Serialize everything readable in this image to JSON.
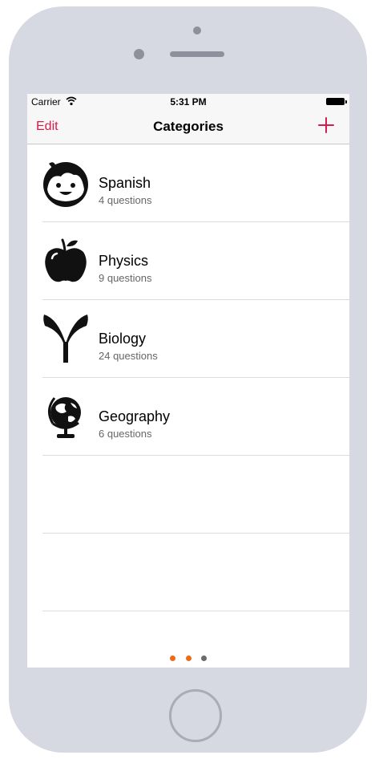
{
  "status_bar": {
    "carrier": "Carrier",
    "time": "5:31 PM"
  },
  "nav_bar": {
    "left_label": "Edit",
    "title": "Categories",
    "right_icon": "plus-icon",
    "accent_color": "#d81b4a"
  },
  "categories": [
    {
      "name": "Spanish",
      "count_label": "4 questions",
      "icon": "child-face-icon"
    },
    {
      "name": "Physics",
      "count_label": "9 questions",
      "icon": "apple-icon"
    },
    {
      "name": "Biology",
      "count_label": "24 questions",
      "icon": "sprout-icon"
    },
    {
      "name": "Geography",
      "count_label": "6 questions",
      "icon": "globe-icon"
    }
  ],
  "empty_rows": 2,
  "page_indicator": {
    "count": 3,
    "active_color": "#ef6a18",
    "inactive_color": "#6b6b6b",
    "active": [
      0,
      1
    ]
  }
}
